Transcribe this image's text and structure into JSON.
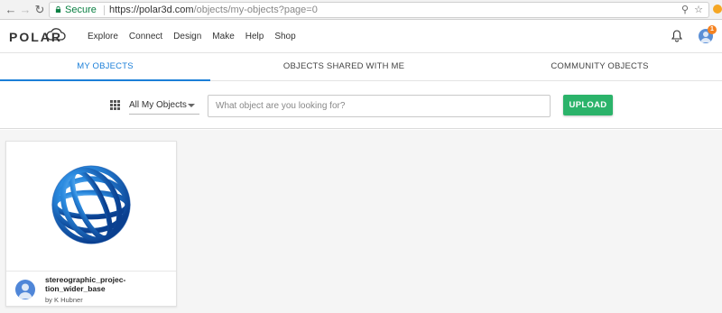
{
  "browser": {
    "secure_label": "Secure",
    "url_host": "https://polar3d.com",
    "url_path": "/objects/my-objects?page=0"
  },
  "header": {
    "logo_text": "POLAR",
    "menu": [
      "Explore",
      "Connect",
      "Design",
      "Make",
      "Help",
      "Shop"
    ],
    "notification_count": "1"
  },
  "tabs": [
    {
      "label": "MY OBJECTS",
      "active": true
    },
    {
      "label": "OBJECTS SHARED WITH ME",
      "active": false
    },
    {
      "label": "COMMUNITY OBJECTS",
      "active": false
    }
  ],
  "filter": {
    "selected": "All My Objects",
    "search_placeholder": "What object are you looking for?",
    "upload_label": "UPLOAD"
  },
  "objects": [
    {
      "name": "stereographic_projec-tion_wider_base",
      "owner": "by K Hubner"
    }
  ],
  "colors": {
    "accent": "#1b7fd8",
    "upload": "#2bb36a",
    "notification": "#f58220"
  }
}
